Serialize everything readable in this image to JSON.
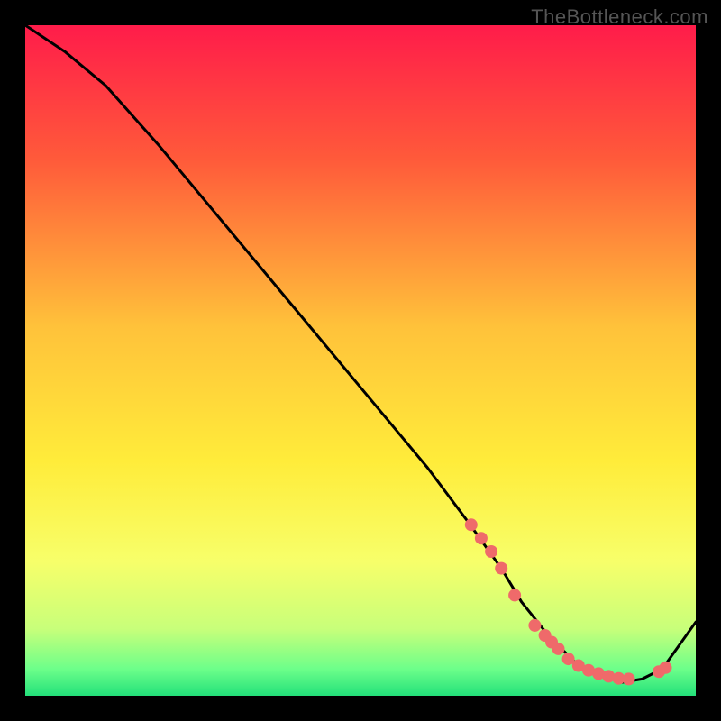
{
  "watermark": "TheBottleneck.com",
  "chart_data": {
    "type": "line",
    "title": "",
    "xlabel": "",
    "ylabel": "",
    "xlim": [
      0,
      100
    ],
    "ylim": [
      0,
      100
    ],
    "gradient_stops": [
      {
        "offset": 0,
        "color": "#ff1c4a"
      },
      {
        "offset": 20,
        "color": "#ff5a3a"
      },
      {
        "offset": 45,
        "color": "#ffc23a"
      },
      {
        "offset": 65,
        "color": "#ffec3a"
      },
      {
        "offset": 80,
        "color": "#f7ff6a"
      },
      {
        "offset": 90,
        "color": "#c8ff7a"
      },
      {
        "offset": 96,
        "color": "#6dff8a"
      },
      {
        "offset": 100,
        "color": "#23e07a"
      }
    ],
    "series": [
      {
        "name": "curve",
        "type": "line",
        "x": [
          0,
          6,
          12,
          20,
          30,
          40,
          50,
          60,
          66,
          71,
          74,
          78,
          82,
          86,
          89,
          92,
          95,
          100
        ],
        "y": [
          100,
          96,
          91,
          82,
          70,
          58,
          46,
          34,
          26,
          19,
          14,
          9,
          5,
          3,
          2,
          2.5,
          4,
          11
        ]
      },
      {
        "name": "highlight-points",
        "type": "scatter",
        "color": "#ef6a6a",
        "x": [
          66.5,
          68,
          69.5,
          71,
          73,
          76,
          77.5,
          78.5,
          79.5,
          81,
          82.5,
          84,
          85.5,
          87,
          88.5,
          90,
          94.5,
          95.5
        ],
        "y": [
          25.5,
          23.5,
          21.5,
          19,
          15,
          10.5,
          9,
          8,
          7,
          5.5,
          4.5,
          3.8,
          3.3,
          2.9,
          2.6,
          2.5,
          3.6,
          4.2
        ]
      }
    ]
  }
}
